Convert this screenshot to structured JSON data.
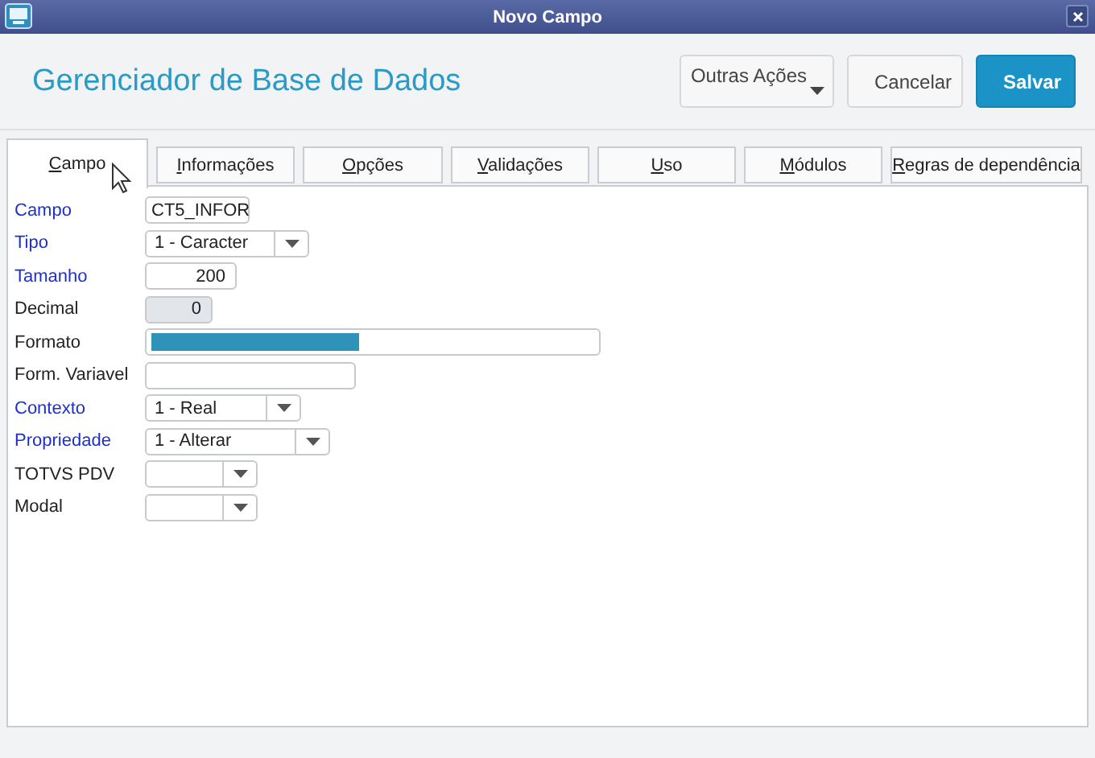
{
  "window": {
    "title": "Novo Campo"
  },
  "header": {
    "title": "Gerenciador de Base de Dados",
    "buttons": [
      {
        "label": "Outras Ações",
        "kind": "menu"
      },
      {
        "label": "Cancelar",
        "kind": "plain"
      },
      {
        "label": "Salvar",
        "kind": "primary"
      }
    ]
  },
  "tabs": [
    {
      "label": "Campo",
      "selected": true
    },
    {
      "label": "Informações",
      "selected": false
    },
    {
      "label": "Opções",
      "selected": false
    },
    {
      "label": "Validações",
      "selected": false
    },
    {
      "label": "Uso",
      "selected": false
    },
    {
      "label": "Módulos",
      "selected": false
    },
    {
      "label": "Regras de dependência",
      "selected": false
    }
  ],
  "fields": [
    {
      "label": "Campo",
      "required": true,
      "kind": "text",
      "value": "CT5_INFOR"
    },
    {
      "label": "Tipo",
      "required": true,
      "kind": "select",
      "value": "1 - Caracter"
    },
    {
      "label": "Tamanho",
      "required": true,
      "kind": "number",
      "value": "200",
      "disabled": false
    },
    {
      "label": "Decimal",
      "required": false,
      "kind": "number",
      "value": "0",
      "disabled": true
    },
    {
      "label": "Formato",
      "required": false,
      "kind": "highlighted"
    },
    {
      "label": "Form. Variavel",
      "required": false,
      "kind": "text"
    },
    {
      "label": "Contexto",
      "required": true,
      "kind": "select",
      "value": "1 - Real"
    },
    {
      "label": "Propriedade",
      "required": true,
      "kind": "select",
      "value": "1 - Alterar"
    },
    {
      "label": "TOTVS PDV",
      "required": false,
      "kind": "select"
    },
    {
      "label": "Modal",
      "required": false,
      "kind": "select"
    }
  ]
}
